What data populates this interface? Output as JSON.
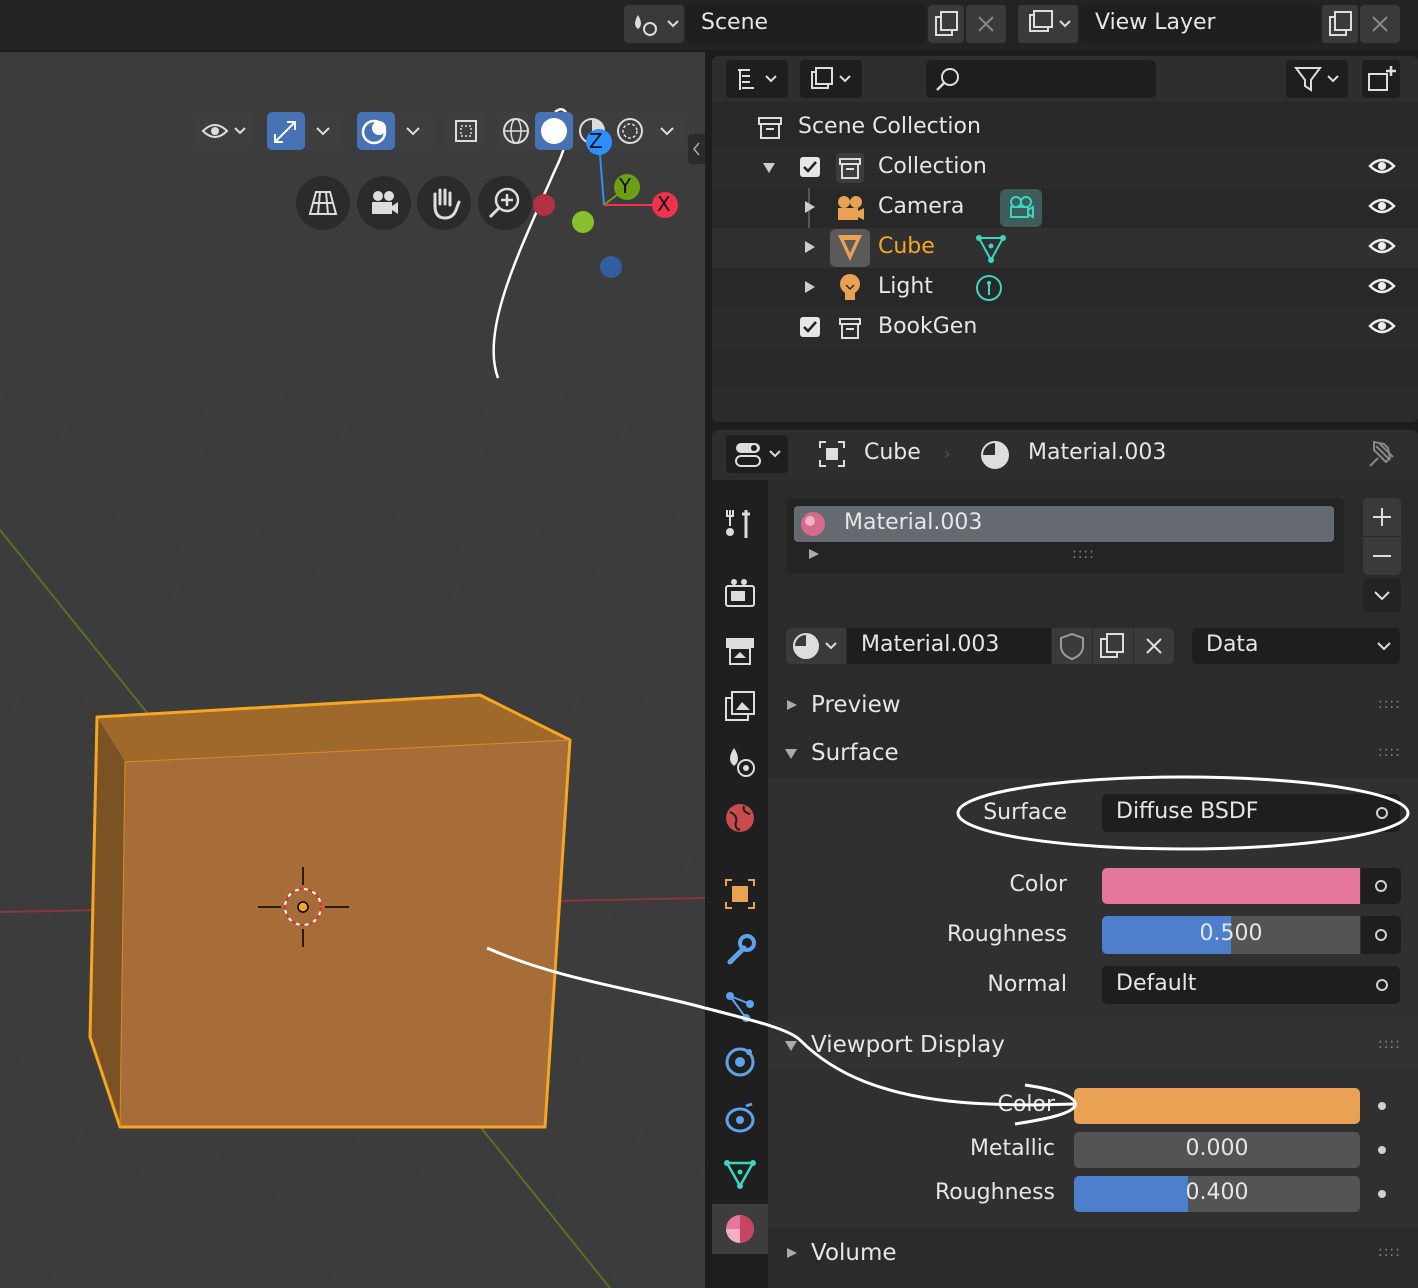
{
  "header": {
    "scene_label": "Scene",
    "view_layer_label": "View Layer"
  },
  "outliner": {
    "scene_collection": "Scene Collection",
    "items": [
      {
        "label": "Collection"
      },
      {
        "label": "Camera"
      },
      {
        "label": "Cube"
      },
      {
        "label": "Light"
      },
      {
        "label": "BookGen"
      }
    ]
  },
  "gizmo": {
    "z": "Z",
    "y": "Y",
    "x": "X"
  },
  "properties": {
    "breadcrumb_object": "Cube",
    "breadcrumb_material": "Material.003",
    "slot_name": "Material.003",
    "material_name": "Material.003",
    "link_mode": "Data",
    "panels": {
      "preview": "Preview",
      "surface": "Surface",
      "viewport_display": "Viewport Display",
      "volume": "Volume"
    },
    "surface": {
      "surface_label": "Surface",
      "surface_value": "Diffuse BSDF",
      "color_label": "Color",
      "color_value": "#e4779a",
      "roughness_label": "Roughness",
      "roughness_value": "0.500",
      "roughness_fraction": 0.5,
      "normal_label": "Normal",
      "normal_value": "Default"
    },
    "viewport_display": {
      "color_label": "Color",
      "color_value": "#e9a154",
      "metallic_label": "Metallic",
      "metallic_value": "0.000",
      "roughness_label": "Roughness",
      "roughness_value": "0.400",
      "roughness_fraction": 0.4
    }
  },
  "colors": {
    "accent": "#4772b3",
    "selected_orange": "#f5a623",
    "object_orange": "#e9a154",
    "axis_x": "#f0324e",
    "axis_y": "#6c9f16",
    "axis_z": "#2c8fff"
  }
}
